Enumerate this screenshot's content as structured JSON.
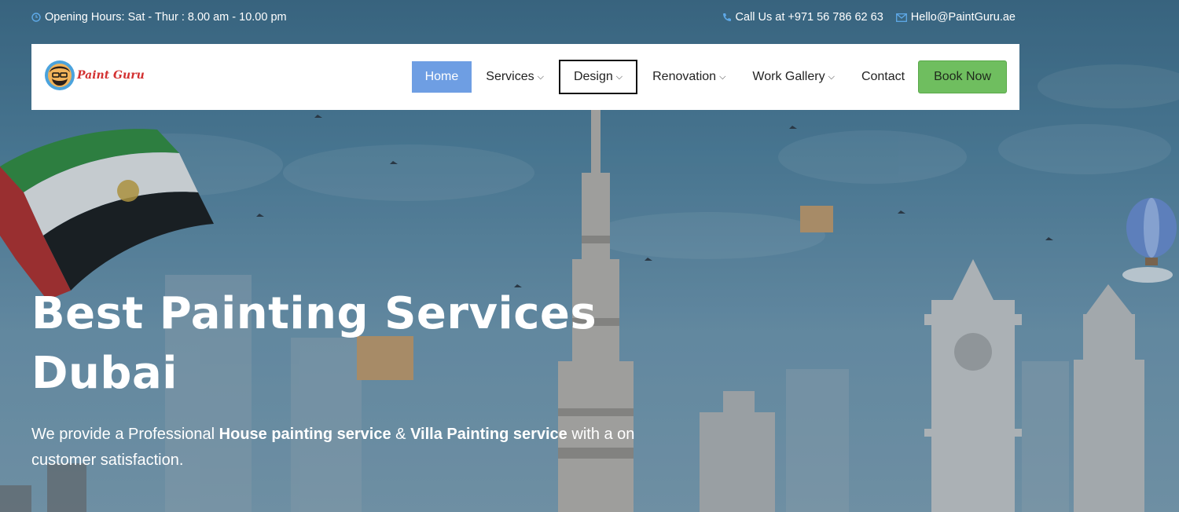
{
  "topbar": {
    "hours": "Opening Hours: Sat - Thur : 8.00 am - 10.00 pm",
    "phone": "Call Us at +971 56 786 62 63",
    "email": "Hello@PaintGuru.ae"
  },
  "brand": {
    "logo_text": "Paint Guru"
  },
  "nav": {
    "home": "Home",
    "services": "Services",
    "design": "Design",
    "renovation": "Renovation",
    "work_gallery": "Work Gallery",
    "contact": "Contact",
    "book_now": "Book Now"
  },
  "hero": {
    "title_line1": "Best Painting Services",
    "title_line2": "Dubai",
    "desc_part1": "We provide a Professional ",
    "desc_bold1": "House painting service",
    "desc_part2": " & ",
    "desc_bold2": "Villa Painting service",
    "desc_part3": " with a on customer satisfaction."
  },
  "colors": {
    "accent_home": "#6e9ee3",
    "book_button": "#6fbe5f",
    "logo_red": "#d33131",
    "topbar_icon": "#5ea9e8"
  },
  "icons": [
    "clock-icon",
    "phone-icon",
    "mail-icon",
    "chevron-down-icon"
  ]
}
